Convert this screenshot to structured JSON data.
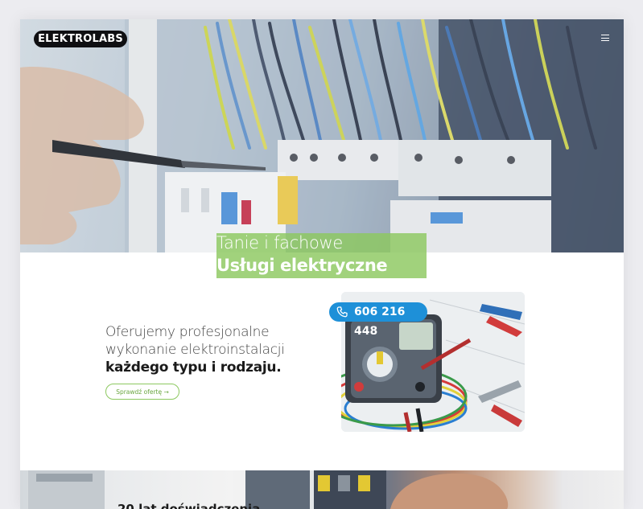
{
  "header": {
    "logo_text": "ELEKTROLABS",
    "menu_icon": "hamburger-icon"
  },
  "hero": {
    "headline_light": "Tanie i fachowe",
    "headline_bold": "Usługi elektryczne",
    "accent_color": "#8cc85f"
  },
  "offer": {
    "line1": "Oferujemy profesjonalne",
    "line2": "wykonanie elektroinstalacji",
    "line3": "każdego typu i rodzaju.",
    "cta_label": "Sprawdź ofertę →",
    "phone": "606 216 448",
    "phone_icon": "phone-icon",
    "phone_color": "#1e90d8"
  },
  "bottom": {
    "title": "20 lat doświadczenia"
  }
}
